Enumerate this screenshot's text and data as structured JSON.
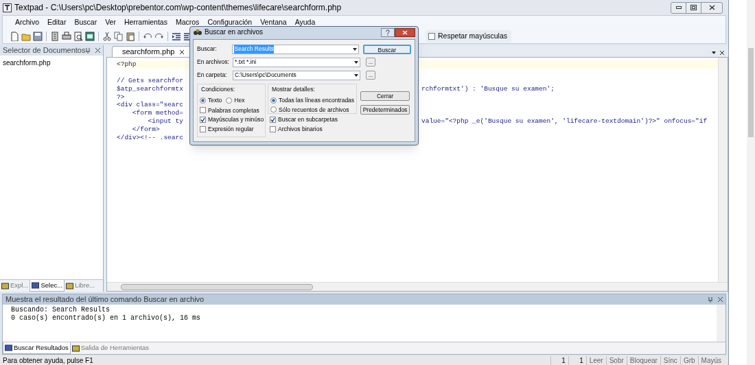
{
  "window": {
    "title": "Textpad - C:\\Users\\pc\\Desktop\\prebentor.com\\wp-content\\themes\\lifecare\\searchform.php"
  },
  "menu": [
    "Archivo",
    "Editar",
    "Buscar",
    "Ver",
    "Herramientas",
    "Macros",
    "Configuración",
    "Ventana",
    "Ayuda"
  ],
  "toolbar": {
    "match_case": {
      "label": "Respetar mayúsculas",
      "checked": false
    }
  },
  "document_panel": {
    "title": "Selector de Documentos",
    "items": [
      "searchform.php"
    ],
    "tabs": [
      {
        "label": "Expl...",
        "selected": false
      },
      {
        "label": "Selec...",
        "selected": true
      },
      {
        "label": "Libre...",
        "selected": false
      }
    ]
  },
  "editor": {
    "tab": "searchform.php",
    "lines": [
      {
        "left": "<?php"
      },
      {
        "left": "// Gets searchfor",
        "space_before": true
      },
      {
        "left": "$atp_searchformtx",
        "right": "rchformtxt') : 'Busque su examen';"
      },
      {
        "left": "?>"
      },
      {
        "left": "<div class=\"searc"
      },
      {
        "left": "    <form method="
      },
      {
        "left": "        <input ty",
        "right": "value=\"<?php _e('Busque su examen', 'lifecare-textdomain')?>\" onfocus=\"if"
      },
      {
        "left": "    </form>"
      },
      {
        "left": "</div><!-- .searc"
      }
    ]
  },
  "dialog": {
    "title": "Buscar en archivos",
    "fields": [
      {
        "label": "Buscar:",
        "value": "Search Results",
        "selected_text": true
      },
      {
        "label": "En archivos:",
        "value": "*.txt *.ini",
        "selected_text": false
      },
      {
        "label": "En carpeta:",
        "value": "C:\\Users\\pc\\Documents",
        "selected_text": false
      }
    ],
    "browse_button": "...",
    "conditions": {
      "title": "Condiciones:",
      "radios": [
        {
          "label": "Texto",
          "selected": true
        },
        {
          "label": "Hex",
          "selected": false
        }
      ],
      "checkboxes": [
        {
          "label": "Palabras completas",
          "checked": false
        },
        {
          "label": "Mayúsculas y minúso",
          "checked": true
        },
        {
          "label": "Expresión regular",
          "checked": false
        }
      ]
    },
    "details": {
      "title": "Mostrar detalles:",
      "radios": [
        {
          "label": "Todas las líneas encontradas",
          "selected": true
        },
        {
          "label": "Sólo recuentos de archivos",
          "selected": false
        }
      ],
      "checkboxes": [
        {
          "label": "Buscar en subcarpetas",
          "checked": true
        },
        {
          "label": "Archivos binarios",
          "checked": false
        }
      ]
    },
    "buttons": [
      "Buscar",
      "Cerrar",
      "Predeterminados"
    ]
  },
  "output": {
    "title": "Muestra el resultado del último comando Buscar en archivo",
    "lines": [
      "Buscando: Search Results",
      "0 caso(s) encontrado(s) en 1 archivo(s), 16 ms"
    ],
    "tabs": [
      {
        "label": "Buscar Resultados",
        "selected": true
      },
      {
        "label": "Salida de Herramientas",
        "selected": false
      }
    ]
  },
  "status_bar": {
    "help": "Para obtener ayuda, pulse F1",
    "fields": [
      "1",
      "1",
      "Leer",
      "Sobr",
      "Bloquear",
      "Sínc",
      "Grb",
      "Mayús"
    ]
  }
}
